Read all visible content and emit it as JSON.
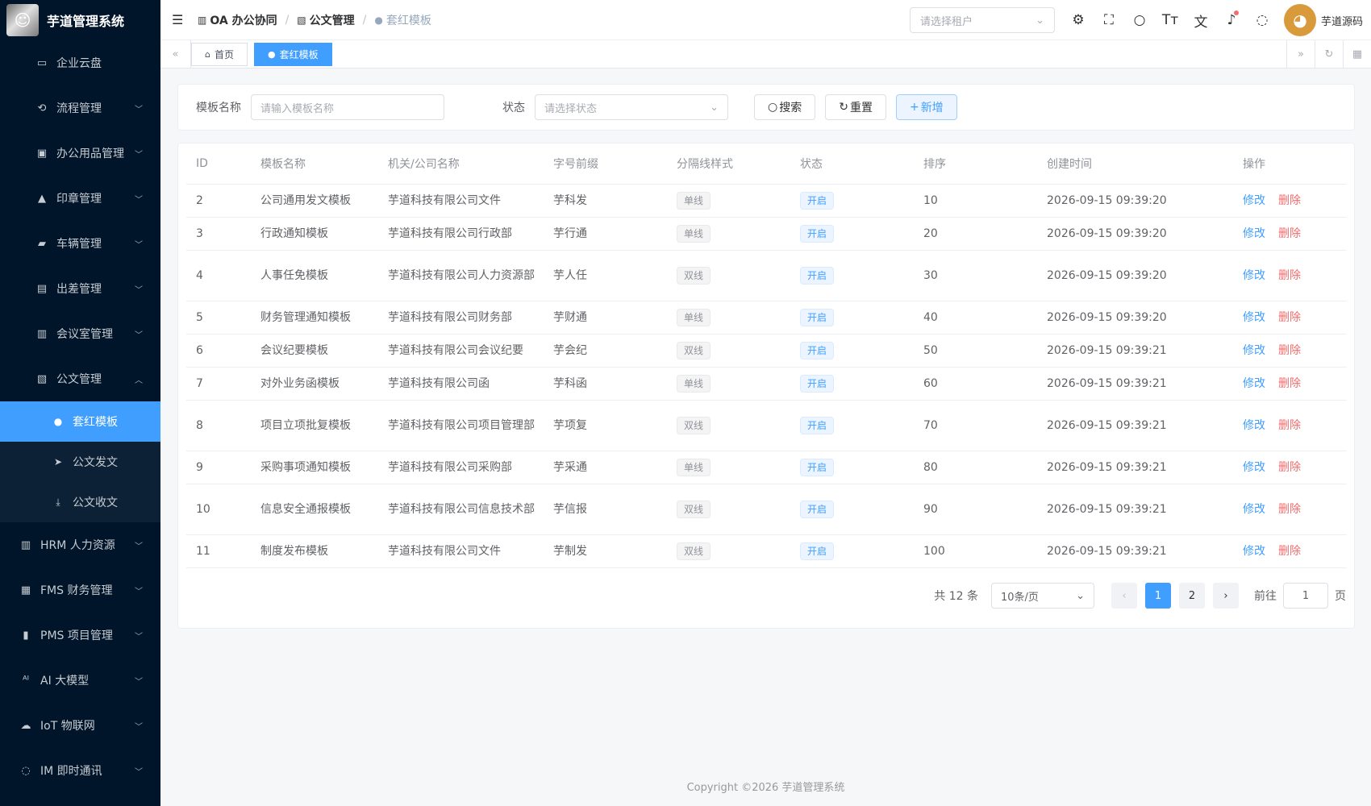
{
  "app": {
    "title": "芋道管理系统"
  },
  "sidebar": {
    "items": [
      {
        "label": "企业云盘",
        "icon": "folder-icon",
        "glyph": "▭",
        "chev": false
      },
      {
        "label": "流程管理",
        "icon": "flow-icon",
        "glyph": "⟲",
        "chev": true
      },
      {
        "label": "办公用品管理",
        "icon": "briefcase-icon",
        "glyph": "▣",
        "chev": true
      },
      {
        "label": "印章管理",
        "icon": "stamp-icon",
        "glyph": "▲",
        "chev": true
      },
      {
        "label": "车辆管理",
        "icon": "truck-icon",
        "glyph": "▰",
        "chev": true
      },
      {
        "label": "出差管理",
        "icon": "suitcase-icon",
        "glyph": "▤",
        "chev": true
      },
      {
        "label": "会议室管理",
        "icon": "building-icon",
        "glyph": "▥",
        "chev": true
      },
      {
        "label": "公文管理",
        "icon": "document-icon",
        "glyph": "▧",
        "chev": true,
        "open": true
      }
    ],
    "subitems": [
      {
        "label": "套红模板",
        "icon": "user-icon",
        "glyph": "●"
      },
      {
        "label": "公文发文",
        "icon": "send-icon",
        "glyph": "➤"
      },
      {
        "label": "公文收文",
        "icon": "download-icon",
        "glyph": "⤓"
      }
    ],
    "bottom": [
      {
        "label": "HRM 人力资源",
        "icon": "building-icon",
        "glyph": "▥"
      },
      {
        "label": "FMS 财务管理",
        "icon": "money-icon",
        "glyph": "▦"
      },
      {
        "label": "PMS 项目管理",
        "icon": "chart-icon",
        "glyph": "▮"
      },
      {
        "label": "AI 大模型",
        "icon": "ai-icon",
        "glyph": "ᴬᴵ"
      },
      {
        "label": "IoT 物联网",
        "icon": "cloud-icon",
        "glyph": "☁"
      },
      {
        "label": "IM 即时通讯",
        "icon": "chat-icon",
        "glyph": "◌"
      }
    ]
  },
  "breadcrumb": [
    {
      "label": "OA 办公协同",
      "icon": "building-icon",
      "glyph": "▥"
    },
    {
      "label": "公文管理",
      "icon": "document-icon",
      "glyph": "▧"
    },
    {
      "label": "套红模板",
      "icon": "user-icon",
      "glyph": "●"
    }
  ],
  "navbar": {
    "tenant_placeholder": "请选择租户",
    "user_name": "芋道源码"
  },
  "tags": {
    "home": "首页",
    "current": "套红模板"
  },
  "search": {
    "name_label": "模板名称",
    "name_placeholder": "请输入模板名称",
    "status_label": "状态",
    "status_placeholder": "请选择状态",
    "search_btn": "搜索",
    "reset_btn": "重置",
    "add_btn": "新增"
  },
  "table": {
    "headers": [
      "ID",
      "模板名称",
      "机关/公司名称",
      "字号前缀",
      "分隔线样式",
      "状态",
      "排序",
      "创建时间",
      "操作"
    ],
    "edit_label": "修改",
    "delete_label": "删除",
    "rows": [
      {
        "id": "2",
        "name": "公司通用发文模板",
        "org": "芋道科技有限公司文件",
        "prefix": "芋科发",
        "line": "单线",
        "status": "开启",
        "sort": "10",
        "time": "2026-09-15 09:39:20",
        "tall": false
      },
      {
        "id": "3",
        "name": "行政通知模板",
        "org": "芋道科技有限公司行政部",
        "prefix": "芋行通",
        "line": "单线",
        "status": "开启",
        "sort": "20",
        "time": "2026-09-15 09:39:20",
        "tall": false
      },
      {
        "id": "4",
        "name": "人事任免模板",
        "org": "芋道科技有限公司人力资源部",
        "prefix": "芋人任",
        "line": "双线",
        "status": "开启",
        "sort": "30",
        "time": "2026-09-15 09:39:20",
        "tall": true
      },
      {
        "id": "5",
        "name": "财务管理通知模板",
        "org": "芋道科技有限公司财务部",
        "prefix": "芋财通",
        "line": "单线",
        "status": "开启",
        "sort": "40",
        "time": "2026-09-15 09:39:20",
        "tall": false
      },
      {
        "id": "6",
        "name": "会议纪要模板",
        "org": "芋道科技有限公司会议纪要",
        "prefix": "芋会纪",
        "line": "双线",
        "status": "开启",
        "sort": "50",
        "time": "2026-09-15 09:39:21",
        "tall": false
      },
      {
        "id": "7",
        "name": "对外业务函模板",
        "org": "芋道科技有限公司函",
        "prefix": "芋科函",
        "line": "单线",
        "status": "开启",
        "sort": "60",
        "time": "2026-09-15 09:39:21",
        "tall": false
      },
      {
        "id": "8",
        "name": "项目立项批复模板",
        "org": "芋道科技有限公司项目管理部",
        "prefix": "芋项复",
        "line": "双线",
        "status": "开启",
        "sort": "70",
        "time": "2026-09-15 09:39:21",
        "tall": true
      },
      {
        "id": "9",
        "name": "采购事项通知模板",
        "org": "芋道科技有限公司采购部",
        "prefix": "芋采通",
        "line": "单线",
        "status": "开启",
        "sort": "80",
        "time": "2026-09-15 09:39:21",
        "tall": false
      },
      {
        "id": "10",
        "name": "信息安全通报模板",
        "org": "芋道科技有限公司信息技术部",
        "prefix": "芋信报",
        "line": "双线",
        "status": "开启",
        "sort": "90",
        "time": "2026-09-15 09:39:21",
        "tall": true
      },
      {
        "id": "11",
        "name": "制度发布模板",
        "org": "芋道科技有限公司文件",
        "prefix": "芋制发",
        "line": "双线",
        "status": "开启",
        "sort": "100",
        "time": "2026-09-15 09:39:21",
        "tall": false
      }
    ]
  },
  "pagination": {
    "total_text": "共 12 条",
    "page_size": "10条/页",
    "pages": [
      "1",
      "2"
    ],
    "current": "1",
    "goto_label": "前往",
    "goto_value": "1",
    "page_unit": "页"
  },
  "footer": {
    "copyright": "Copyright ©2026 芋道管理系统"
  },
  "colors": {
    "primary": "#409eff",
    "sidebar_bg": "#001529",
    "danger": "#f56c6c"
  }
}
